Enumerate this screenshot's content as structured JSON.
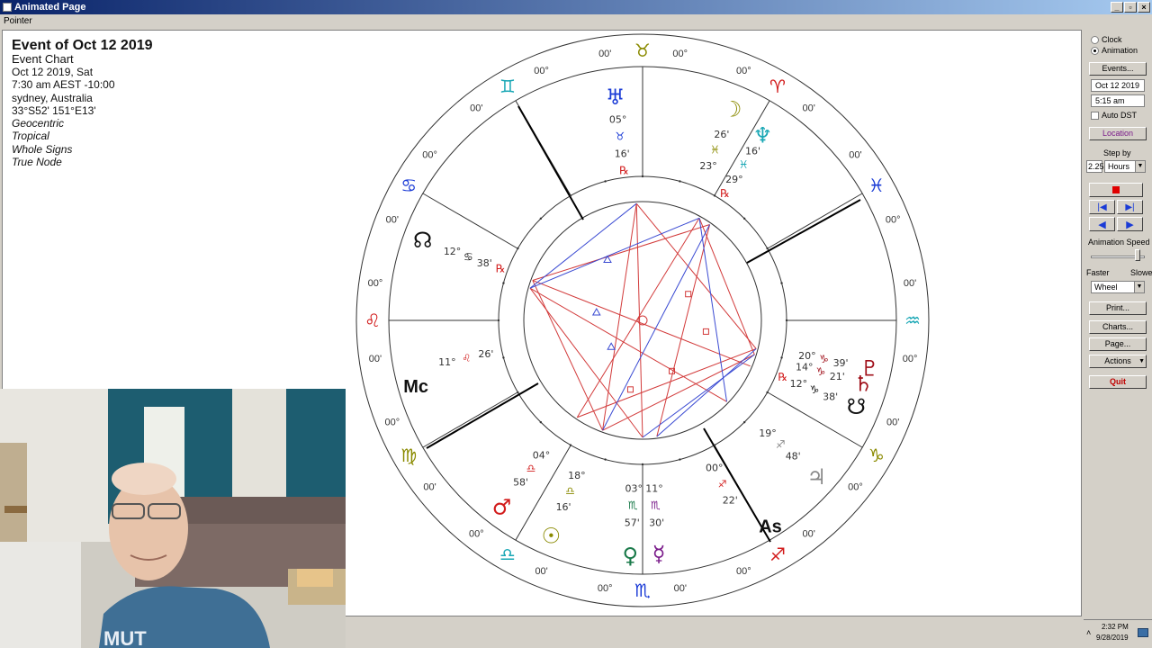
{
  "window": {
    "title": "Animated Page"
  },
  "menu": {
    "pointer_label": "Pointer"
  },
  "chart_info": {
    "title": "Event of Oct 12 2019",
    "subtitle": "Event Chart",
    "date_line": "Oct 12 2019, Sat",
    "time_line": "7:30 am  AEST -10:00",
    "location_line": "sydney, Australia",
    "coords_line": "33°S52' 151°E13'",
    "settings": [
      "Geocentric",
      "Tropical",
      "Whole Signs",
      "True Node"
    ]
  },
  "wheel": {
    "outer_signs": [
      {
        "glyph": "♉",
        "color": "#8a8a00",
        "deg_left": "00'",
        "deg_right": "00°"
      },
      {
        "glyph": "♈",
        "color": "#d21c1c",
        "deg_left": "00°",
        "deg_right": "00'"
      },
      {
        "glyph": "♓",
        "color": "#1a3bd6",
        "deg_left": "00'",
        "deg_right": "00°"
      },
      {
        "glyph": "♒",
        "color": "#19a7b5",
        "deg_left": "00'",
        "deg_right": "00°"
      },
      {
        "glyph": "♑",
        "color": "#8a8a00",
        "deg_left": "00'",
        "deg_right": "00°"
      },
      {
        "glyph": "♐",
        "color": "#d21c1c",
        "deg_left": "00'",
        "deg_right": "00°"
      },
      {
        "glyph": "♏",
        "color": "#1a3bd6",
        "deg_left": "00'",
        "deg_right": "00°"
      },
      {
        "glyph": "♎",
        "color": "#19a7b5",
        "deg_left": "00'",
        "deg_right": "00°"
      },
      {
        "glyph": "♍",
        "color": "#8a8a00",
        "deg_left": "00'",
        "deg_right": "00°"
      },
      {
        "glyph": "♌",
        "color": "#d21c1c",
        "deg_left": "00'",
        "deg_right": "00°"
      },
      {
        "glyph": "♋",
        "color": "#1a3bd6",
        "deg_left": "00'",
        "deg_right": "00°"
      },
      {
        "glyph": "♊",
        "color": "#19a7b5",
        "deg_left": "00'",
        "deg_right": "00°"
      }
    ],
    "planets": [
      {
        "name": "uranus",
        "glyph": "♅",
        "color": "#1a3bd6",
        "lines": [
          "05°",
          "♉",
          "16'",
          "℞"
        ]
      },
      {
        "name": "moon",
        "glyph": "☽",
        "color": "#8a8a00",
        "lines": [
          "26'",
          "♓",
          "23°"
        ]
      },
      {
        "name": "neptune",
        "glyph": "♆",
        "color": "#19a7b5",
        "lines": [
          "16'",
          "♓",
          "29°",
          "℞"
        ]
      },
      {
        "name": "pluto",
        "glyph": "♇",
        "color": "#a0101a",
        "lines": [
          "39'",
          "♑",
          "20°"
        ]
      },
      {
        "name": "saturn",
        "glyph": "♄",
        "color": "#a0101a",
        "lines": [
          "21'",
          "♑",
          "14°"
        ]
      },
      {
        "name": "south-node",
        "glyph": "☋",
        "color": "#111111",
        "lines": [
          "38'",
          "♑",
          "12°",
          "℞"
        ]
      },
      {
        "name": "north-node",
        "glyph": "☊",
        "color": "#111111",
        "lines": [
          "12°",
          "♋",
          "38'",
          "℞"
        ]
      },
      {
        "name": "jupiter",
        "glyph": "♃",
        "color": "#888888",
        "lines": [
          "48'",
          "♐",
          "19°"
        ]
      },
      {
        "name": "mercury",
        "glyph": "☿",
        "color": "#7a1b8a",
        "lines": [
          "30'",
          "♏",
          "11°"
        ]
      },
      {
        "name": "venus",
        "glyph": "♀",
        "color": "#1a7a4a",
        "lines": [
          "57'",
          "♏",
          "03°"
        ]
      },
      {
        "name": "sun",
        "glyph": "☉",
        "color": "#8a8a00",
        "lines": [
          "16'",
          "♎",
          "18°"
        ]
      },
      {
        "name": "mars",
        "glyph": "♂",
        "color": "#d21c1c",
        "lines": [
          "58'",
          "♎",
          "04°"
        ]
      }
    ],
    "mc": {
      "label": "Mc",
      "lines": [
        "11°",
        "♌",
        "26'"
      ]
    },
    "asc": {
      "label": "As",
      "lines": [
        "22'",
        "♐",
        "00°"
      ]
    }
  },
  "panel": {
    "clock_label": "Clock",
    "animation_label": "Animation",
    "animation_selected": true,
    "events_button": "Events...",
    "date_value": "Oct 12 2019",
    "time_value": "5:15 am",
    "auto_dst_label": "Auto DST",
    "location_button": "Location",
    "step_by_label": "Step by",
    "step_value": "2.25",
    "step_unit": "Hours",
    "animation_speed_label": "Animation Speed",
    "faster_label": "Faster",
    "slower_label": "Slower",
    "view_mode": "Wheel",
    "print_button": "Print...",
    "charts_button": "Charts...",
    "page_button": "Page...",
    "actions_button": "Actions",
    "quit_button": "Quit"
  },
  "tray": {
    "time": "2:32 PM",
    "date": "9/28/2019"
  },
  "colors": {
    "fire": "#d21c1c",
    "earth": "#8a8a00",
    "air": "#19a7b5",
    "water": "#1a3bd6"
  }
}
